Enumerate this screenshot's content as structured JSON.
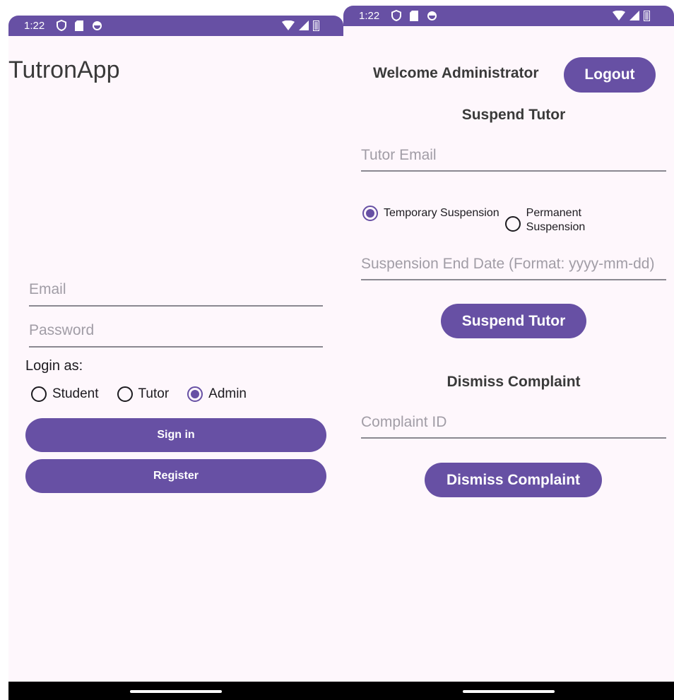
{
  "status_bar": {
    "time": "1:22"
  },
  "login_screen": {
    "app_title": "TutronApp",
    "email_placeholder": "Email",
    "password_placeholder": "Password",
    "login_as_label": "Login as:",
    "roles": [
      {
        "label": "Student",
        "selected": false
      },
      {
        "label": "Tutor",
        "selected": false
      },
      {
        "label": "Admin",
        "selected": true
      }
    ],
    "sign_in_label": "Sign in",
    "register_label": "Register"
  },
  "admin_screen": {
    "welcome_text": "Welcome Administrator",
    "logout_label": "Logout",
    "suspend_heading": "Suspend Tutor",
    "tutor_email_placeholder": "Tutor Email",
    "suspension_types": [
      {
        "label": "Temporary Suspension",
        "selected": true
      },
      {
        "label": "Permanent Suspension",
        "selected": false
      }
    ],
    "end_date_placeholder": "Suspension End Date (Format: yyyy-mm-dd)",
    "suspend_button_label": "Suspend Tutor",
    "dismiss_heading": "Dismiss Complaint",
    "complaint_id_placeholder": "Complaint ID",
    "dismiss_button_label": "Dismiss Complaint"
  },
  "colors": {
    "primary": "#6750a4",
    "background": "#fef7fc",
    "nav": "#000000"
  },
  "icons": [
    "shield-icon",
    "sd-card-icon",
    "sync-icon",
    "wifi-icon",
    "signal-icon",
    "battery-icon"
  ]
}
